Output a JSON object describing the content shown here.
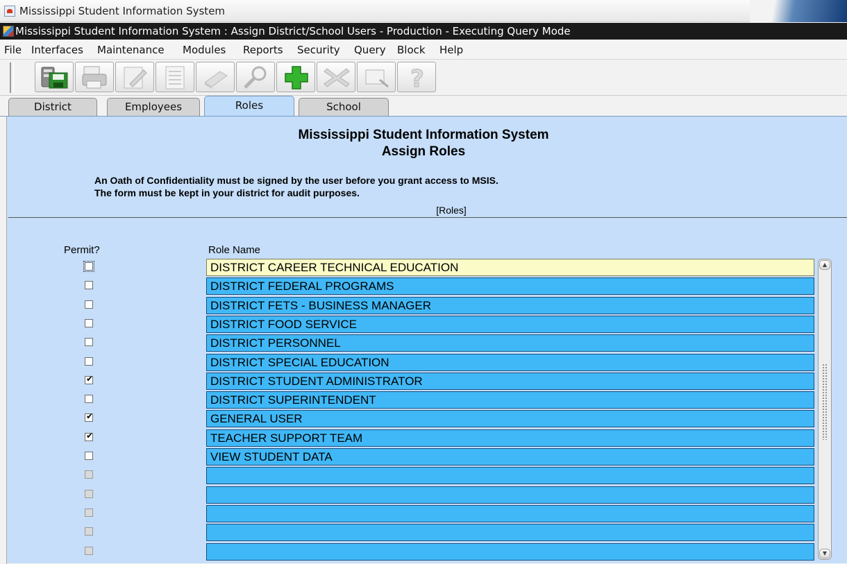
{
  "window": {
    "outer_title": "Mississippi Student Information System",
    "inner_title": "Mississippi Student Information System : Assign District/School Users  -  Production  -  Executing Query Mode"
  },
  "menu": [
    "File",
    "Interfaces",
    "Maintenance",
    "Modules",
    "Reports",
    "Security",
    "Query",
    "Block",
    "Help"
  ],
  "toolbar": {
    "buttons": [
      {
        "name": "save-icon",
        "enabled": true
      },
      {
        "name": "print-icon",
        "enabled": false
      },
      {
        "name": "edit-icon",
        "enabled": false
      },
      {
        "name": "document-icon",
        "enabled": false
      },
      {
        "name": "eraser-icon",
        "enabled": false
      },
      {
        "name": "search-icon",
        "enabled": false
      },
      {
        "name": "add-icon",
        "enabled": true
      },
      {
        "name": "delete-icon",
        "enabled": false
      },
      {
        "name": "exit-icon",
        "enabled": false
      },
      {
        "name": "help-icon",
        "enabled": false
      }
    ]
  },
  "tabs": [
    {
      "label": "District",
      "active": false
    },
    {
      "label": "Employees",
      "active": false
    },
    {
      "label": "Roles",
      "active": true
    },
    {
      "label": "School",
      "active": false
    }
  ],
  "form": {
    "heading_line1": "Mississippi Student Information System",
    "heading_line2": "Assign Roles",
    "notice_line1": "An Oath of Confidentiality must be signed by the user before you grant access to MSIS.",
    "notice_line2": "The form must be kept in your district for audit purposes.",
    "block_label": "[Roles]",
    "col_permit": "Permit?",
    "col_role_name": "Role Name"
  },
  "roles": [
    {
      "name": "DISTRICT CAREER TECHNICAL EDUCATION",
      "permit": false
    },
    {
      "name": "DISTRICT FEDERAL PROGRAMS",
      "permit": false
    },
    {
      "name": "DISTRICT FETS - BUSINESS MANAGER",
      "permit": false
    },
    {
      "name": "DISTRICT FOOD SERVICE",
      "permit": false
    },
    {
      "name": "DISTRICT PERSONNEL",
      "permit": false
    },
    {
      "name": "DISTRICT SPECIAL EDUCATION",
      "permit": false
    },
    {
      "name": "DISTRICT STUDENT ADMINISTRATOR",
      "permit": true
    },
    {
      "name": "DISTRICT SUPERINTENDENT",
      "permit": false
    },
    {
      "name": "GENERAL USER",
      "permit": true
    },
    {
      "name": "TEACHER SUPPORT TEAM",
      "permit": true
    },
    {
      "name": "VIEW STUDENT DATA",
      "permit": false
    },
    {
      "name": "",
      "permit": false
    },
    {
      "name": "",
      "permit": false
    },
    {
      "name": "",
      "permit": false
    },
    {
      "name": "",
      "permit": false
    },
    {
      "name": "",
      "permit": false
    }
  ],
  "colors": {
    "content_bg": "#c6def9",
    "field_bg": "#40b8f7",
    "current_field_bg": "#fbfbc8"
  }
}
